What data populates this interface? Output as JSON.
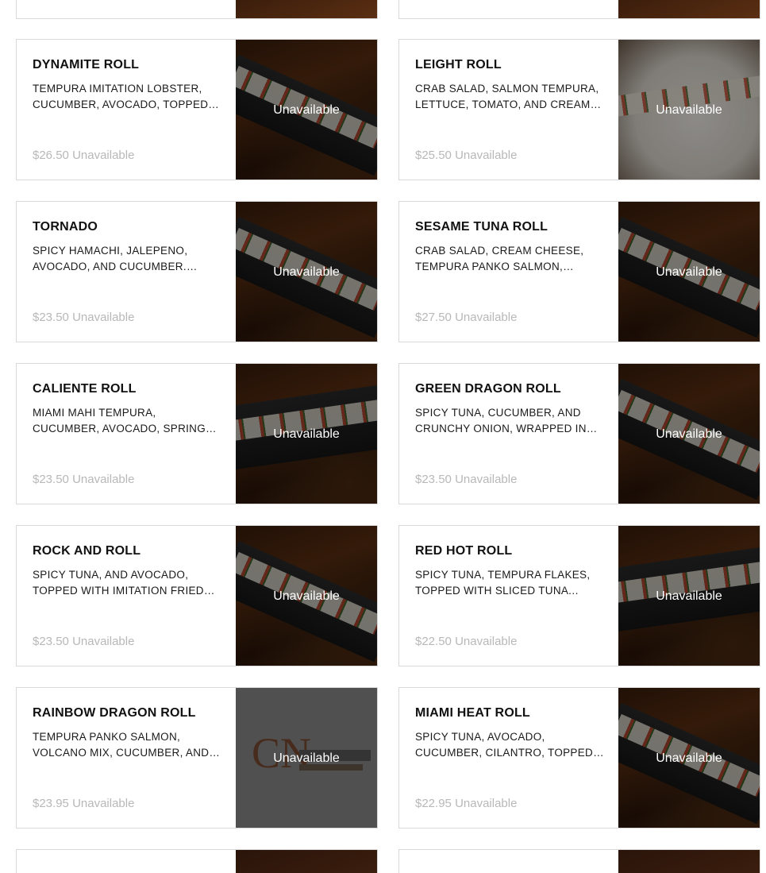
{
  "unavailable_label": "Unavailable",
  "items": [
    {
      "name": "DYNAMITE ROLL",
      "description": "TEMPURA IMITATION LOBSTER, CUCUMBER, AVOCADO, TOPPED…",
      "price": "$26.50",
      "status": "Unavailable",
      "image": "dark"
    },
    {
      "name": "LEIGHT ROLL",
      "description": "CRAB SALAD, SALMON TEMPURA, LETTUCE, TOMATO, AND CREAM…",
      "price": "$25.50",
      "status": "Unavailable",
      "image": "plate"
    },
    {
      "name": "TORNADO",
      "description": "SPICY HAMACHI, JALEPENO, AVOCADO, AND CUCUMBER.…",
      "price": "$23.50",
      "status": "Unavailable",
      "image": "dark"
    },
    {
      "name": "SESAME TUNA ROLL",
      "description": "CRAB SALAD, CREAM CHEESE, TEMPURA PANKO SALMON,…",
      "price": "$27.50",
      "status": "Unavailable",
      "image": "dark"
    },
    {
      "name": "CALIENTE ROLL",
      "description": "MIAMI MAHI TEMPURA, CUCUMBER, AVOCADO, SPRING…",
      "price": "$23.50",
      "status": "Unavailable",
      "image": "dark"
    },
    {
      "name": "GREEN DRAGON ROLL",
      "description": "SPICY TUNA, CUCUMBER, AND CRUNCHY ONION, WRAPPED IN…",
      "price": "$23.50",
      "status": "Unavailable",
      "image": "dark"
    },
    {
      "name": "ROCK AND ROLL",
      "description": "SPICY TUNA, AND AVOCADO, TOPPED WITH IMITATION FRIED…",
      "price": "$23.50",
      "status": "Unavailable",
      "image": "dark"
    },
    {
      "name": "RED HOT ROLL",
      "description": "SPICY TUNA, TEMPURA FLAKES, TOPPED WITH SLICED TUNA AND…",
      "price": "$22.50",
      "status": "Unavailable",
      "image": "dark"
    },
    {
      "name": "RAINBOW DRAGON ROLL",
      "description": "TEMPURA PANKO SALMON, VOLCANO MIX, CUCUMBER, AND…",
      "price": "$23.95",
      "status": "Unavailable",
      "image": "logo"
    },
    {
      "name": "MIAMI HEAT ROLL",
      "description": "SPICY TUNA, AVOCADO, CUCUMBER, CILANTRO, TOPPED…",
      "price": "$22.95",
      "status": "Unavailable",
      "image": "dark"
    }
  ]
}
